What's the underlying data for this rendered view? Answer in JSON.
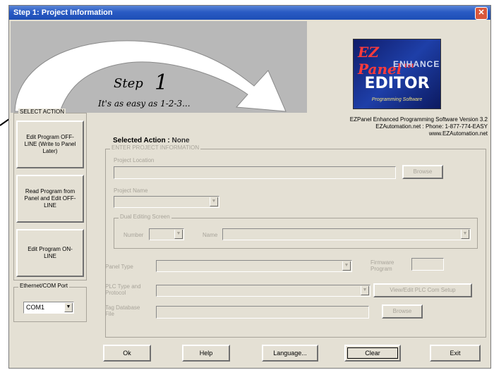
{
  "window": {
    "title": "Step 1: Project Information",
    "close": "✕"
  },
  "banner": {
    "step_word": "Step",
    "step_number": "1",
    "tagline": "It's as easy as 1-2-3..."
  },
  "logo": {
    "brand": "EZ Panel™",
    "enhanced": "ENHANCED",
    "editor": "EDITOR",
    "subtitle": "Programming Software"
  },
  "info": {
    "line1": "EZPanel Enhanced Programming Software Version 3.2",
    "line2": "EZAutomation.net : Phone: 1-877-774-EASY",
    "line3": "www.EZAutomation.net"
  },
  "select_action": {
    "title": "SELECT ACTION",
    "buttons": [
      "Edit Program OFF-LINE (Write to Panel Later)",
      "Read Program from Panel and Edit OFF-LINE",
      "Edit Program ON-LINE"
    ]
  },
  "port": {
    "title": "Ethernet/COM Port",
    "value": "COM1"
  },
  "selected_action": {
    "label": "Selected Action :",
    "value": "None"
  },
  "project": {
    "title": "ENTER PROJECT INFORMATION",
    "location_label": "Project Location",
    "browse": "Browse",
    "name_label": "Project Name",
    "tag_group_title": "Dual Editing Screen",
    "number_label": "Number",
    "name_field_label": "Name",
    "panel_type_label": "Panel Type",
    "firmware_label": "Firmware Program",
    "plc_label": "PLC Type and Protocol",
    "plc_button": "View/Edit PLC Com Setup",
    "tag_db_label": "Tag Database File",
    "tag_browse": "Browse"
  },
  "footer": {
    "ok": "Ok",
    "help": "Help",
    "language": "Language...",
    "clear": "Clear",
    "exit": "Exit"
  },
  "colors": {
    "window_bg": "#e4e0d4",
    "titlebar": "#2a5bc4",
    "disabled_text": "#a8a49a"
  }
}
